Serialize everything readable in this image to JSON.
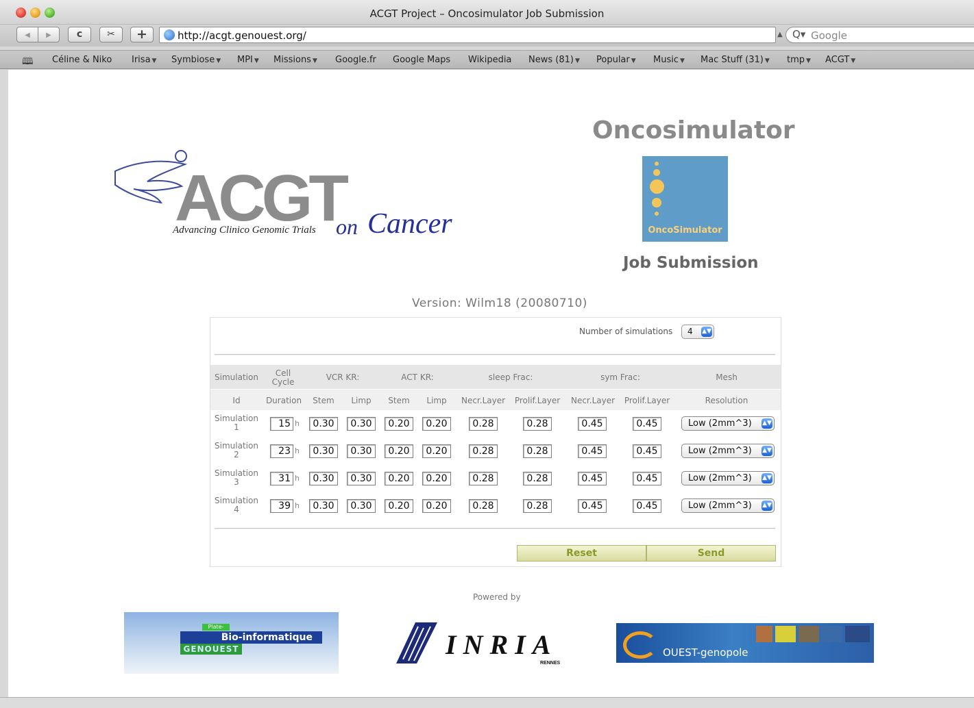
{
  "window": {
    "title": "ACGT Project – Oncosimulator Job Submission"
  },
  "toolbar": {
    "back_glyph": "◀",
    "forward_glyph": "▶",
    "reload_glyph": "c",
    "snapshot_glyph": "✂",
    "add_glyph": "+",
    "url": "http://acgt.genouest.org/",
    "search_placeholder": "Google",
    "search_glyph": "Q▾"
  },
  "bookmarks": {
    "items": [
      {
        "label": "Céline & Niko",
        "menu": false
      },
      {
        "label": "Irisa",
        "menu": true
      },
      {
        "label": "Symbiose",
        "menu": true
      },
      {
        "label": "MPI",
        "menu": true
      },
      {
        "label": "Missions",
        "menu": true
      },
      {
        "label": "Google.fr",
        "menu": false
      },
      {
        "label": "Google Maps",
        "menu": false
      },
      {
        "label": "Wikipedia",
        "menu": false
      },
      {
        "label": "News (81)",
        "menu": true
      },
      {
        "label": "Popular",
        "menu": true
      },
      {
        "label": "Music",
        "menu": true
      },
      {
        "label": "Mac Stuff (31)",
        "menu": true
      },
      {
        "label": "tmp",
        "menu": true
      },
      {
        "label": "ACGT",
        "menu": true
      }
    ]
  },
  "header": {
    "acgt_big": "ACGT",
    "acgt_tagline": "Advancing Clinico Genomic Trials",
    "acgt_on": "on",
    "acgt_cancer": "Cancer",
    "oncosim_title": "Oncosimulator",
    "oncosim_logo_text": "OncoSimulator",
    "job_submission": "Job Submission",
    "version": "Version: Wilm18 (20080710)"
  },
  "form": {
    "num_sim_label": "Number of simulations",
    "num_sim_value": "4",
    "head1": {
      "simulation": "Simulation",
      "cell_cycle": "Cell Cycle",
      "vcr_kr": "VCR KR:",
      "act_kr": "ACT KR:",
      "sleep_frac": "sleep Frac:",
      "sym_frac": "sym Frac:",
      "mesh": "Mesh"
    },
    "head2": {
      "id": "Id",
      "duration": "Duration",
      "stem1": "Stem",
      "limp1": "Limp",
      "stem2": "Stem",
      "limp2": "Limp",
      "necr1": "Necr.Layer",
      "prolif1": "Prolif.Layer",
      "necr2": "Necr.Layer",
      "prolif2": "Prolif.Layer",
      "resolution": "Resolution"
    },
    "unit_hours": "h",
    "rows": [
      {
        "label": "Simulation",
        "num": "1",
        "duration": "15",
        "vcr_stem": "0.30",
        "vcr_limp": "0.30",
        "act_stem": "0.20",
        "act_limp": "0.20",
        "sleep_necr": "0.28",
        "sleep_prolif": "0.28",
        "sym_necr": "0.45",
        "sym_prolif": "0.45",
        "resolution": "Low (2mm^3)"
      },
      {
        "label": "Simulation",
        "num": "2",
        "duration": "23",
        "vcr_stem": "0.30",
        "vcr_limp": "0.30",
        "act_stem": "0.20",
        "act_limp": "0.20",
        "sleep_necr": "0.28",
        "sleep_prolif": "0.28",
        "sym_necr": "0.45",
        "sym_prolif": "0.45",
        "resolution": "Low (2mm^3)"
      },
      {
        "label": "Simulation",
        "num": "3",
        "duration": "31",
        "vcr_stem": "0.30",
        "vcr_limp": "0.30",
        "act_stem": "0.20",
        "act_limp": "0.20",
        "sleep_necr": "0.28",
        "sleep_prolif": "0.28",
        "sym_necr": "0.45",
        "sym_prolif": "0.45",
        "resolution": "Low (2mm^3)"
      },
      {
        "label": "Simulation",
        "num": "4",
        "duration": "39",
        "vcr_stem": "0.30",
        "vcr_limp": "0.30",
        "act_stem": "0.20",
        "act_limp": "0.20",
        "sleep_necr": "0.28",
        "sleep_prolif": "0.28",
        "sym_necr": "0.45",
        "sym_prolif": "0.45",
        "resolution": "Low (2mm^3)"
      }
    ],
    "reset_label": "Reset",
    "send_label": "Send"
  },
  "footer": {
    "powered_by": "Powered by",
    "genouest_small": "Plate-forme",
    "genouest_main": "Bio-informatique",
    "genouest_name": "GENOUEST",
    "inria_name": "INRIA",
    "inria_city": "RENNES",
    "ouest_name": "OUEST-genopole"
  },
  "colors": {
    "accent_button": "#d8dca0",
    "oncosim_blue": "#5f9dc8",
    "select_blue": "#1a62d6"
  }
}
